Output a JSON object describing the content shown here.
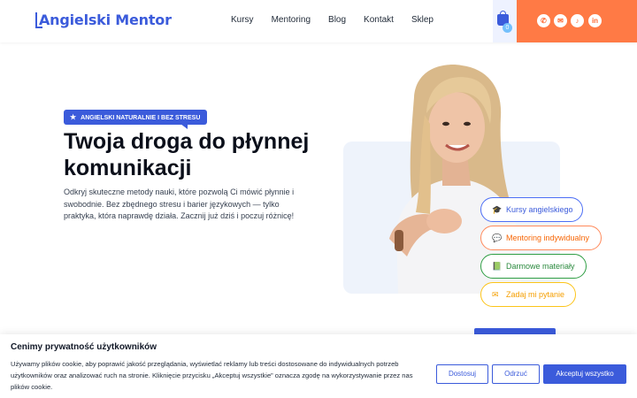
{
  "header": {
    "logo_text": "Angielski Mentor",
    "nav": [
      "Kursy",
      "Mentoring",
      "Blog",
      "Kontakt",
      "Sklep"
    ],
    "cart_count": "0",
    "social": [
      {
        "icon": "phone-icon",
        "glyph": "✆"
      },
      {
        "icon": "mail-icon",
        "glyph": "✉"
      },
      {
        "icon": "tiktok-icon",
        "glyph": "♪"
      },
      {
        "icon": "linkedin-icon",
        "glyph": "in"
      }
    ]
  },
  "hero": {
    "badge": "ANGIELSKI NATURALNIE I BEZ STRESU",
    "title": "Twoja droga do płynnej komunikacji",
    "description": "Odkryj skuteczne metody nauki, które pozwolą Ci mówić płynnie i swobodnie. Bez zbędnego stresu i barier językowych — tylko praktyka, która naprawdę działa. Zacznij już dziś i poczuj różnicę!"
  },
  "pills": [
    {
      "label": "Kursy angielskiego",
      "icon": "graduation-cap-icon"
    },
    {
      "label": "Mentoring indywidualny",
      "icon": "chat-icon"
    },
    {
      "label": "Darmowe materiały",
      "icon": "book-icon"
    },
    {
      "label": "Zadaj mi pytanie",
      "icon": "envelope-icon"
    }
  ],
  "cookie": {
    "title": "Cenimy prywatność użytkowników",
    "text": "Używamy plików cookie, aby poprawić jakość przeglądania, wyświetlać reklamy lub treści dostosowane do indywidualnych potrzeb użytkowników oraz analizować ruch na stronie. Kliknięcie przycisku „Akceptuj wszystkie” oznacza zgodę na wykorzystywanie przez nas plików cookie.",
    "btn_customize": "Dostosuj",
    "btn_reject": "Odrzuć",
    "btn_accept": "Akceptuj wszystko"
  },
  "colors": {
    "brand": "#3b5bdb",
    "accent": "#ff7a45"
  }
}
